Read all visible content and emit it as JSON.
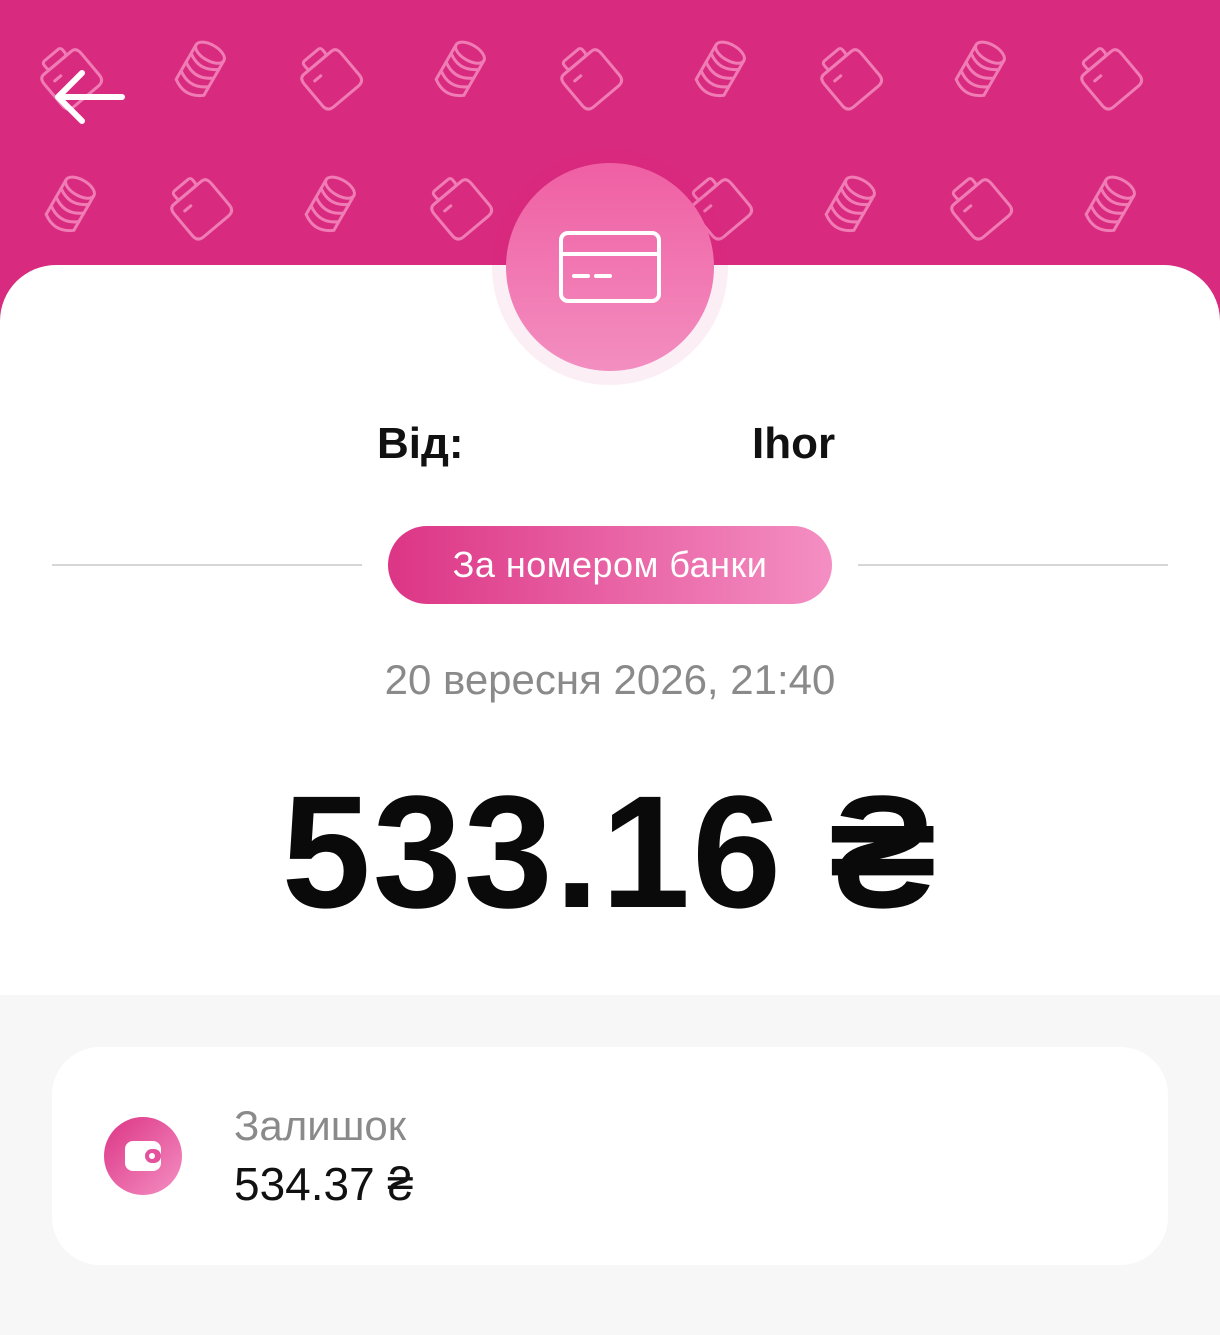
{
  "header": {
    "back_icon": "arrow-left-icon",
    "background_color": "#d82a7e",
    "pattern_icons": [
      "jar-icon",
      "coins-icon"
    ]
  },
  "transaction": {
    "type_icon": "credit-card-icon",
    "from_label": "Від:",
    "from_name": "Ihor",
    "method": "За номером банки",
    "datetime": "20 вересня 2026, 21:40",
    "amount": "533.16 ₴"
  },
  "balance": {
    "icon": "wallet-icon",
    "label": "Залишок",
    "value": "534.37 ₴"
  },
  "colors": {
    "accent": "#d82a7e",
    "accent_light": "#f48fc3",
    "text_primary": "#111111",
    "text_secondary": "#8a8a8a"
  }
}
